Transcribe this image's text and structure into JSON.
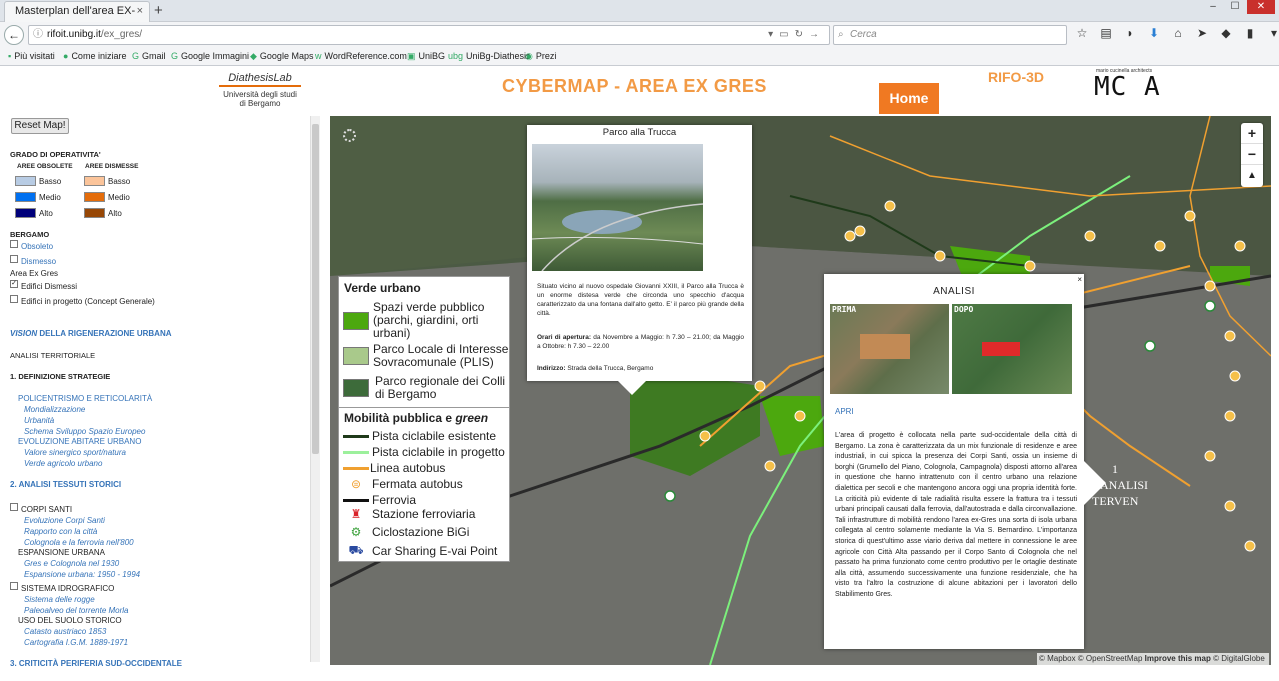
{
  "browser": {
    "tab_title": "Masterplan dell'area EX-GERS",
    "tab_close": "×",
    "new_tab": "+",
    "url_host": "rifoit.unibg.it",
    "url_path": "/ex_gres/",
    "search_placeholder": "Cerca",
    "window_controls": [
      "–",
      "☐",
      "✕"
    ],
    "bookmarks": [
      "Più visitati",
      "Come iniziare",
      "Gmail",
      "Google Immagini",
      "Google Maps",
      "WordReference.com",
      "UniBG",
      "UniBg-Diathesis",
      "Prezi"
    ]
  },
  "header": {
    "logo_left_line1": "DiathesisLab",
    "logo_left_line2": "Università degli studi di Bergamo",
    "title": "CYBERMAP - AREA EX GRES",
    "home_button": "Home",
    "rifo": "RIFO-3D",
    "mca_small": "mario cucinella architects",
    "mca_big": "MC A"
  },
  "sidebar": {
    "reset_button": "Reset Map!",
    "grado_title": "GRADO DI OPERATIVITA'",
    "col_obsolete": "AREE OBSOLETE",
    "col_dismesse": "AREE DISMESSE",
    "levels": [
      "Basso",
      "Medio",
      "Alto"
    ],
    "colors_obsolete": [
      "#b8cce4",
      "#0070f0",
      "#00007a"
    ],
    "colors_dismesse": [
      "#fbc49a",
      "#e46c0a",
      "#974706"
    ],
    "bergamo_title": "BERGAMO",
    "obsoleto": "Obsoleto",
    "dismesso": "Dismesso",
    "area_ex_gres": "Area Ex Gres",
    "edifici_dismessi": "Edifici Dismessi",
    "edifici_progetto": "Edifici in progetto (Concept Generale)",
    "vision_italic": "VISION",
    "vision_rest": " DELLA RIGENERAZIONE URBANA",
    "analisi_territoriale": "ANALISI TERRITORIALE",
    "sec1": "1. DEFINIZIONE STRATEGIE",
    "policentrismo": "POLICENTRISMO E RETICOLARITÀ",
    "mondializzazione": "Mondializzazione",
    "urbanita": "Urbanità",
    "schema": "Schema Sviluppo Spazio Europeo",
    "evoluzione": "EVOLUZIONE ABITARE URBANO",
    "valore": "Valore sinergico sport/natura",
    "verde_agricolo": "Verde agricolo urbano",
    "sec2": "2. ANALISI TESSUTI STORICI",
    "corpi_santi": "CORPI SANTI",
    "evoluzione_corpi": "Evoluzione Corpi Santi",
    "rapporto": "Rapporto con la città",
    "colognola": "Colognola e la ferrovia nell'800",
    "espansione": "ESPANSIONE URBANA",
    "gres": "Gres e Colognola nel 1930",
    "espansione_urbana": "Espansione urbana: 1950 - 1994",
    "sistema": "SISTEMA IDROGRAFICO",
    "rogge": "Sistema delle rogge",
    "paleoalveo": "Paleoalveo del torrente Morla",
    "uso": "USO DEL SUOLO STORICO",
    "catasto": "Catasto austriaco 1853",
    "cartografia": "Cartografia I.G.M. 1889-1971",
    "sec3": "3. CRITICITÀ PERIFERIA SUD-OCCIDENTALE"
  },
  "map_controls": {
    "zoom_in": "+",
    "zoom_out": "−",
    "compass": "▲"
  },
  "legend": {
    "verde_title": "Verde urbano",
    "verde_items": [
      {
        "label": "Spazi verde pubblico (parchi, giardini, orti urbani)",
        "color": "#4ca80e"
      },
      {
        "label": "Parco Locale di Interesse Sovracomunale (PLIS)",
        "color": "#a9c98b"
      },
      {
        "label": "Parco regionale dei Colli di Bergamo",
        "color": "#3d6b3a"
      }
    ],
    "mobilita_title_a": "Mobilità pubblica e ",
    "mobilita_title_b": "green",
    "mobilita_items": [
      {
        "label": "Pista ciclabile esistente",
        "kind": "line",
        "color": "#1f3a1a"
      },
      {
        "label": "Pista ciclabile in progetto",
        "kind": "line",
        "color": "#9cf09c"
      },
      {
        "label": "Linea autobus",
        "kind": "line",
        "color": "#f0a030"
      },
      {
        "label": "Fermata autobus",
        "kind": "icon",
        "icon": "🚌",
        "color": "#f0a030"
      },
      {
        "label": "Ferrovia",
        "kind": "line",
        "color": "#111111"
      },
      {
        "label": "Stazione ferroviaria",
        "kind": "icon",
        "icon": "🚆",
        "color": "#d9232a"
      },
      {
        "label": "Ciclostazione BiGi",
        "kind": "icon",
        "icon": "🚲",
        "color": "#3aa03a"
      },
      {
        "label": "Car Sharing E-vai Point",
        "kind": "icon",
        "icon": "🚗",
        "color": "#2a4aa0"
      }
    ]
  },
  "popup_parco": {
    "title": "Parco alla Trucca",
    "description": "Situato vicino al nuovo ospedale Giovanni XXIII, il Parco alla Trucca è un enorme distesa verde che circonda uno specchio d'acqua caratterizzato da una fontana dall'alto getto. E' il parco più grande della città.",
    "orari_label": "Orari di apertura:",
    "orari_value": " da Novembre a Maggio: h 7.30 – 21.00; da Maggio a Ottobre: h 7.30 – 22.00",
    "indirizzo_label": "Indirizzo:",
    "indirizzo_value": " Strada della Trucca, Bergamo"
  },
  "popup_analisi": {
    "title": "ANALISI",
    "close": "×",
    "prima": "PRIMA",
    "dopo": "DOPO",
    "apri": "APRI",
    "text": "L'area di progetto è collocata nella parte sud-occidentale della città di Bergamo. La zona è caratterizzata da un mix funzionale di residenze e aree industriali, in cui spicca la presenza dei Corpi Santi, ossia un insieme di borghi (Grumello del Piano, Colognola, Campagnola) disposti attorno all'area in questione che hanno intrattenuto con il centro urbano una relazione dialettica per secoli e che mantengono ancora oggi una propria identità forte. La criticità più evidente di tale radialità risulta essere la frattura tra i tessuti urbani principali causati dalla ferrovia, dall'autostrada e dalla circonvallazione. Tali infrastrutture di mobilità rendono l'area ex-Gres una sorta di isola urbana collegata al centro solamente mediante la Via S. Bernardino. L'importanza storica di quest'ultimo asse viario deriva dal mettere in connessione le aree agricole con Città Alta passando per il Corpo Santo di Colognola che nel passato ha prima funzionato come centro produttivo per le ortaglie destinate alla città, assumendo successivamente una funzione residenziale, che ha visto tra l'altro la costruzione di alcune abitazioni per i lavoratori dello Stabilimento Gres."
  },
  "map_labels": {
    "side_1": "1",
    "side_2": "ANALISI",
    "side_3": "TERVEN"
  },
  "attribution": {
    "a": "© Mapbox © OpenStreetMap ",
    "b": "Improve this map",
    "c": " © DigitalGlobe"
  }
}
